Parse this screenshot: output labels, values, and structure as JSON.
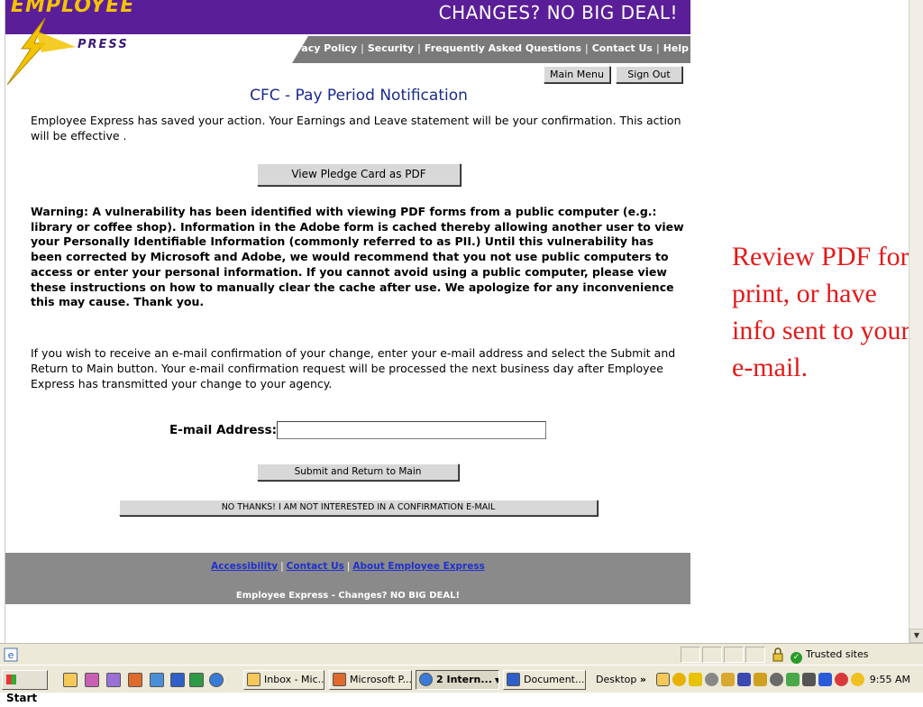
{
  "header": {
    "logo_word1": "EMPLOYEE",
    "logo_word2": "PRESS",
    "slogan": "CHANGES? NO BIG DEAL!",
    "nav_links": [
      "Privacy Policy",
      "Security",
      "Frequently Asked Questions",
      "Contact Us",
      "Help"
    ],
    "separator": "|"
  },
  "toolbar": {
    "main_menu_label": "Main Menu",
    "sign_out_label": "Sign Out"
  },
  "main": {
    "title": "CFC - Pay Period Notification",
    "saved_message": "Employee Express has saved your action. Your Earnings and Leave statement will be your confirmation. This action will be effective .",
    "view_pdf_label": "View Pledge Card as PDF",
    "warning": "Warning: A vulnerability has been identified with viewing PDF forms from a public computer (e.g.: library or coffee shop). Information in the Adobe form is cached thereby allowing another user to view your Personally Identifiable Information (commonly referred to as PII.) Until this vulnerability has been corrected by Microsoft and Adobe, we would recommend that you not use public computers to access or enter your personal information. If you cannot avoid using a public computer, please view these instructions on how to manually clear the cache after use. We apologize for any inconvenience this may cause. Thank you.",
    "confirm_message": "If you wish to receive an e-mail confirmation of your change, enter your e-mail address and select the Submit and Return to Main button. Your e-mail confirmation request will be processed the next business day after Employee Express has transmitted your change to your agency.",
    "email_label": "E-mail Address:",
    "email_value": "",
    "submit_label": "Submit and Return to Main",
    "no_thanks_label": "NO THANKS! I AM NOT INTERESTED IN A CONFIRMATION E-MAIL"
  },
  "footer": {
    "links": [
      "Accessibility",
      "Contact Us",
      "About Employee Express"
    ],
    "tagline": "Employee Express - Changes? NO BIG DEAL!"
  },
  "annotation": {
    "text": "Review PDF for print, or have info sent to your e-mail.",
    "color": "#e31a1a"
  },
  "statusbar": {
    "zone": "Trusted sites"
  },
  "taskbar": {
    "start_label": "Start",
    "tasks": [
      {
        "label": "Inbox - Mic...",
        "icon": "outlook-icon",
        "active": false
      },
      {
        "label": "Microsoft P...",
        "icon": "powerpoint-icon",
        "active": false
      },
      {
        "label": "2 Intern...",
        "icon": "internet-explorer-icon",
        "active": true
      },
      {
        "label": "Document...",
        "icon": "word-icon",
        "active": false
      }
    ],
    "desktop_label": "Desktop",
    "chevron": "»",
    "clock": "9:55 AM"
  },
  "colors": {
    "header_purple": "#5b1e99",
    "logo_gold": "#f3c300",
    "nav_gray": "#7a7a7a",
    "footer_gray": "#8a8a8a",
    "title_blue": "#1a2a8c",
    "link_blue": "#1f2fd0"
  }
}
